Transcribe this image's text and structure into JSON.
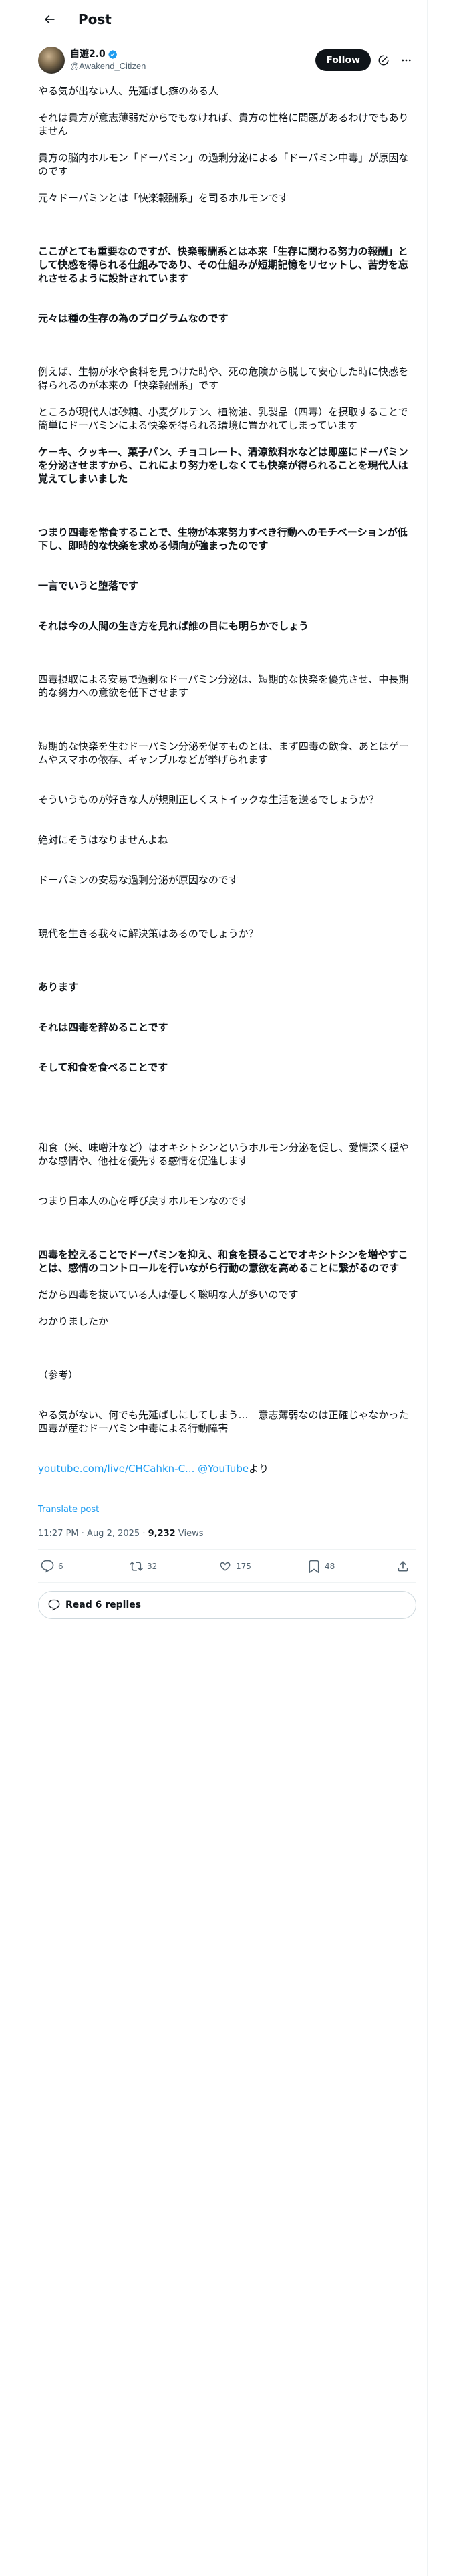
{
  "header": {
    "title": "Post"
  },
  "author": {
    "display_name": "自遊2.0",
    "handle": "@Awakend_Citizen",
    "follow_label": "Follow"
  },
  "tweet": {
    "p1": "やる気が出ない人、先延ばし癖のある人",
    "p2": "それは貴方が意志薄弱だからでもなければ、貴方の性格に問題があるわけでもありません",
    "p3": "貴方の脳内ホルモン「ドーパミン」の過剰分泌による「ドーパミン中毒」が原因なのです",
    "p4": "元々ドーパミンとは「快楽報酬系」を司るホルモンです",
    "p5": "ここがとても重要なのですが、快楽報酬系とは本来「生存に関わる努力の報酬」として快感を得られる仕組みであり、その仕組みが短期記憶をリセットし、苦労を忘れさせるように設計されています",
    "p5b": "元々は種の生存の為のプログラムなのです",
    "p6": "例えば、生物が水や食料を見つけた時や、死の危険から脱して安心した時に快感を得られるのが本来の「快楽報酬系」です",
    "p7": "ところが現代人は砂糖、小麦グルテン、植物油、乳製品（四毒）を摂取することで簡単にドーパミンによる快楽を得られる環境に置かれてしまっています",
    "p8": "ケーキ、クッキー、菓子パン、チョコレート、清涼飲料水などは即座にドーパミンを分泌させますから、これにより努力をしなくても快楽が得られることを現代人は覚えてしまいました",
    "p9": "つまり四毒を常食することで、生物が本来努力すべき行動へのモチベーションが低下し、即時的な快楽を求める傾向が強まったのです",
    "p9b": "一言でいうと堕落です",
    "p9c": "それは今の人間の生き方を見れば誰の目にも明らかでしょう",
    "p10": "四毒摂取による安易で過剰なドーパミン分泌は、短期的な快楽を優先させ、中長期的な努力への意欲を低下させます",
    "p11": "短期的な快楽を生むドーパミン分泌を促すものとは、まず四毒の飲食、あとはゲームやスマホの依存、ギャンブルなどが挙げられます",
    "p11b": "そういうものが好きな人が規則正しくストイックな生活を送るでしょうか？",
    "p11c": "絶対にそうはなりませんよね",
    "p11d": "ドーパミンの安易な過剰分泌が原因なのです",
    "p12": "現代を生きる我々に解決策はあるのでしょうか？",
    "p13a": "あります",
    "p13b": "それは四毒を辞めることです",
    "p13c": "そして和食を食べることです",
    "p14": "和食（米、味噌汁など）はオキシトシンというホルモン分泌を促し、愛情深く穏やかな感情や、他社を優先する感情を促進します",
    "p14b": "つまり日本人の心を呼び戻すホルモンなのです",
    "p15": "四毒を控えることでドーパミンを抑え、和食を摂ることでオキシトシンを増やすことは、感情のコントロールを行いながら行動の意欲を高めることに繋がるのです",
    "p16": "だから四毒を抜いている人は優しく聡明な人が多いのです",
    "p17": "わかりましたか",
    "p18a": "（参考）",
    "p18b": "やる気がない、何でも先延ばしにしてしまう…　意志薄弱なのは正確じゃなかった　四毒が産むドーパミン中毒による行動障害",
    "link_text": "youtube.com/live/CHCahkn-C...",
    "link_via": "@YouTube",
    "link_suffix": "より",
    "translate": "Translate post"
  },
  "meta": {
    "time": "11:27 PM · Aug 2, 2025 · ",
    "views": "9,232",
    "views_label": " Views"
  },
  "actions": {
    "replies": "6",
    "reposts": "32",
    "likes": "175",
    "bookmarks": "48"
  },
  "read_replies": "Read 6 replies",
  "icons": [
    "back-arrow-icon",
    "verified-badge-icon",
    "grok-icon",
    "more-icon",
    "reply-icon",
    "repost-icon",
    "like-icon",
    "bookmark-icon",
    "share-icon",
    "chat-bubble-icon"
  ],
  "colors": {
    "accent": "#1d9bf0",
    "text": "#0f1419",
    "muted": "#536471",
    "border": "#eff3f4"
  }
}
